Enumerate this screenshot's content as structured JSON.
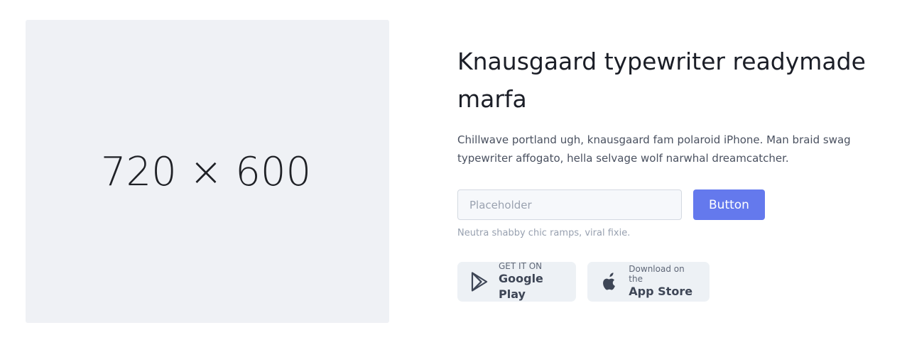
{
  "image_placeholder": {
    "label": "720 × 600"
  },
  "hero": {
    "title": "Knausgaard typewriter readymade marfa",
    "description": "Chillwave portland ugh, knausgaard fam polaroid iPhone. Man braid swag typewriter affogato, hella selvage wolf narwhal dreamcatcher."
  },
  "form": {
    "input_value": "",
    "input_placeholder": "Placeholder",
    "button_label": "Button",
    "helper_text": "Neutra shabby chic ramps, viral fixie."
  },
  "stores": [
    {
      "icon": "google-play-icon",
      "small": "GET IT ON",
      "large": "Google Play"
    },
    {
      "icon": "apple-icon",
      "small": "Download on the",
      "large": "App Store"
    }
  ],
  "colors": {
    "accent": "#6479ed",
    "placeholder_bg": "#eff1f5",
    "store_bg": "#edf1f5",
    "title": "#1b1e27",
    "body_text": "#4a5160",
    "muted_text": "#98a1b0"
  }
}
